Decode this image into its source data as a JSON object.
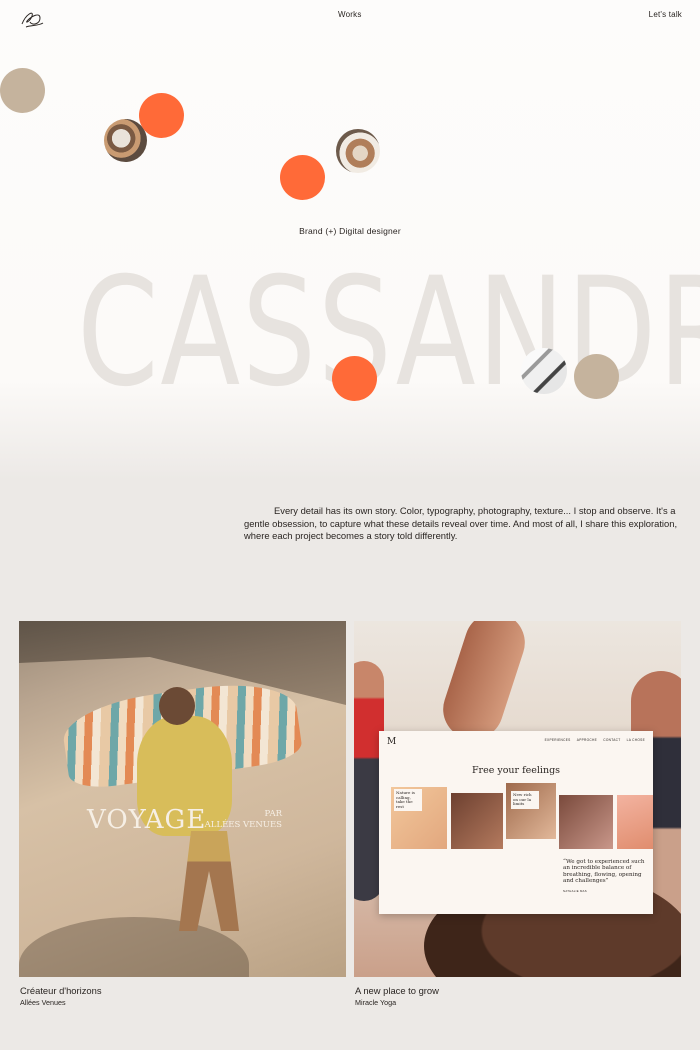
{
  "nav": {
    "logo_icon": "script-flourish-logo",
    "works": "Works",
    "talk": "Let's talk"
  },
  "hero": {
    "tagline": "Brand (+) Digital designer",
    "name": "CASSANDRE"
  },
  "intro": {
    "lines": [
      "Every detail has its own story. Color, typography, photography, texture... I stop and observe. It's a",
      "gentle obsession, to capture what these details reveal over time. And most of all, I share this exploration,",
      "where each project becomes a story told differently."
    ]
  },
  "colors": {
    "accent_orange": "#ff6a38",
    "accent_tan": "#c5b39d",
    "background": "#ece9e6"
  },
  "projects": [
    {
      "title": "Créateur d'horizons",
      "client": "Allées Venues",
      "overlay_title": "VOYAGE",
      "overlay_by": "PAR",
      "overlay_brand": "ALLÉES VENUES"
    },
    {
      "title": "A new place to grow",
      "client": "Miracle Yoga",
      "mockup": {
        "logo": "M",
        "nav": [
          "EXPERIENCES",
          "APPROCHE",
          "CONTACT",
          "LA CHOSE"
        ],
        "headline": "Free your feelings",
        "card1": "Nature is calling, take the rest",
        "card2": "New rich on our la limits",
        "quote": "“We got to experienced such an incredible balance of breathing, flowing, opening and challenges”",
        "quote_author": "NATHALIE MAS"
      }
    }
  ]
}
